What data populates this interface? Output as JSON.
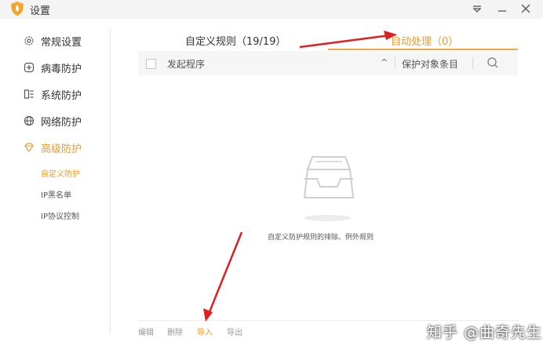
{
  "window": {
    "title": "设置",
    "logo_icon": "shield-logo-icon"
  },
  "titlebar_icons": [
    "dropdown-icon",
    "minimize-icon",
    "close-icon"
  ],
  "sidebar": {
    "items": [
      {
        "label": "常规设置",
        "icon": "gear-icon"
      },
      {
        "label": "病毒防护",
        "icon": "plus-box-icon"
      },
      {
        "label": "系统防护",
        "icon": "system-icon"
      },
      {
        "label": "网络防护",
        "icon": "globe-icon"
      },
      {
        "label": "高级防护",
        "icon": "diamond-icon",
        "active": true
      }
    ],
    "subitems": [
      {
        "label": "自定义防护",
        "active": true
      },
      {
        "label": "IP黑名单"
      },
      {
        "label": "IP协议控制"
      }
    ]
  },
  "tabs": [
    {
      "label": "自定义规则（19/19）"
    },
    {
      "label": "自动处理（0）",
      "active": true
    }
  ],
  "table": {
    "col_program": "发起程序",
    "sort_glyph": "^",
    "col_target": "保护对象条目",
    "search_icon": "search-icon"
  },
  "empty": {
    "icon": "empty-tray-icon",
    "text": "自定义防护规则的排除、例外规则"
  },
  "actions": [
    {
      "label": "编辑"
    },
    {
      "label": "删除"
    },
    {
      "label": "导入",
      "active": true
    },
    {
      "label": "导出"
    }
  ],
  "watermark": "知乎 @曲奇先生",
  "colors": {
    "accent": "#f39a2b",
    "annotation_arrow": "#e02020"
  }
}
